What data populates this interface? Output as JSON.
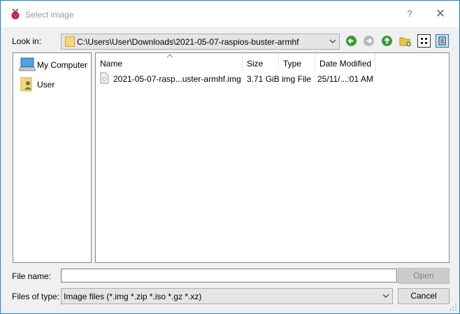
{
  "window": {
    "title": "Select image",
    "help_label": "?",
    "close_label": "✕",
    "icon": "raspberry-pi-icon"
  },
  "toolbar": {
    "lookin_label": "Look in:",
    "path": "C:\\Users\\User\\Downloads\\2021-05-07-raspios-buster-armhf",
    "buttons": [
      "back-icon",
      "forward-icon",
      "parent-folder-icon",
      "new-folder-icon",
      "list-view-icon",
      "detail-view-icon"
    ]
  },
  "sidebar": {
    "items": [
      {
        "label": "My Computer",
        "icon": "computer-icon"
      },
      {
        "label": "User",
        "icon": "user-folder-icon"
      }
    ]
  },
  "files": {
    "columns": [
      "Name",
      "Size",
      "Type",
      "Date Modified"
    ],
    "rows": [
      {
        "name": "2021-05-07-rasp...uster-armhf.img",
        "size": "3.71 GiB",
        "type": "img File",
        "date": "25/11/...:01 AM"
      }
    ]
  },
  "footer": {
    "filename_label": "File name:",
    "filename_value": "",
    "open_label": "Open",
    "filetype_label": "Files of type:",
    "filetype_value": "Image files (*.img *.zip *.iso *.gz *.xz)",
    "cancel_label": "Cancel"
  },
  "colors": {
    "window_border": "#1883d7",
    "nav_green": "#3a9a3a",
    "selected_view": "#cce4f7"
  }
}
